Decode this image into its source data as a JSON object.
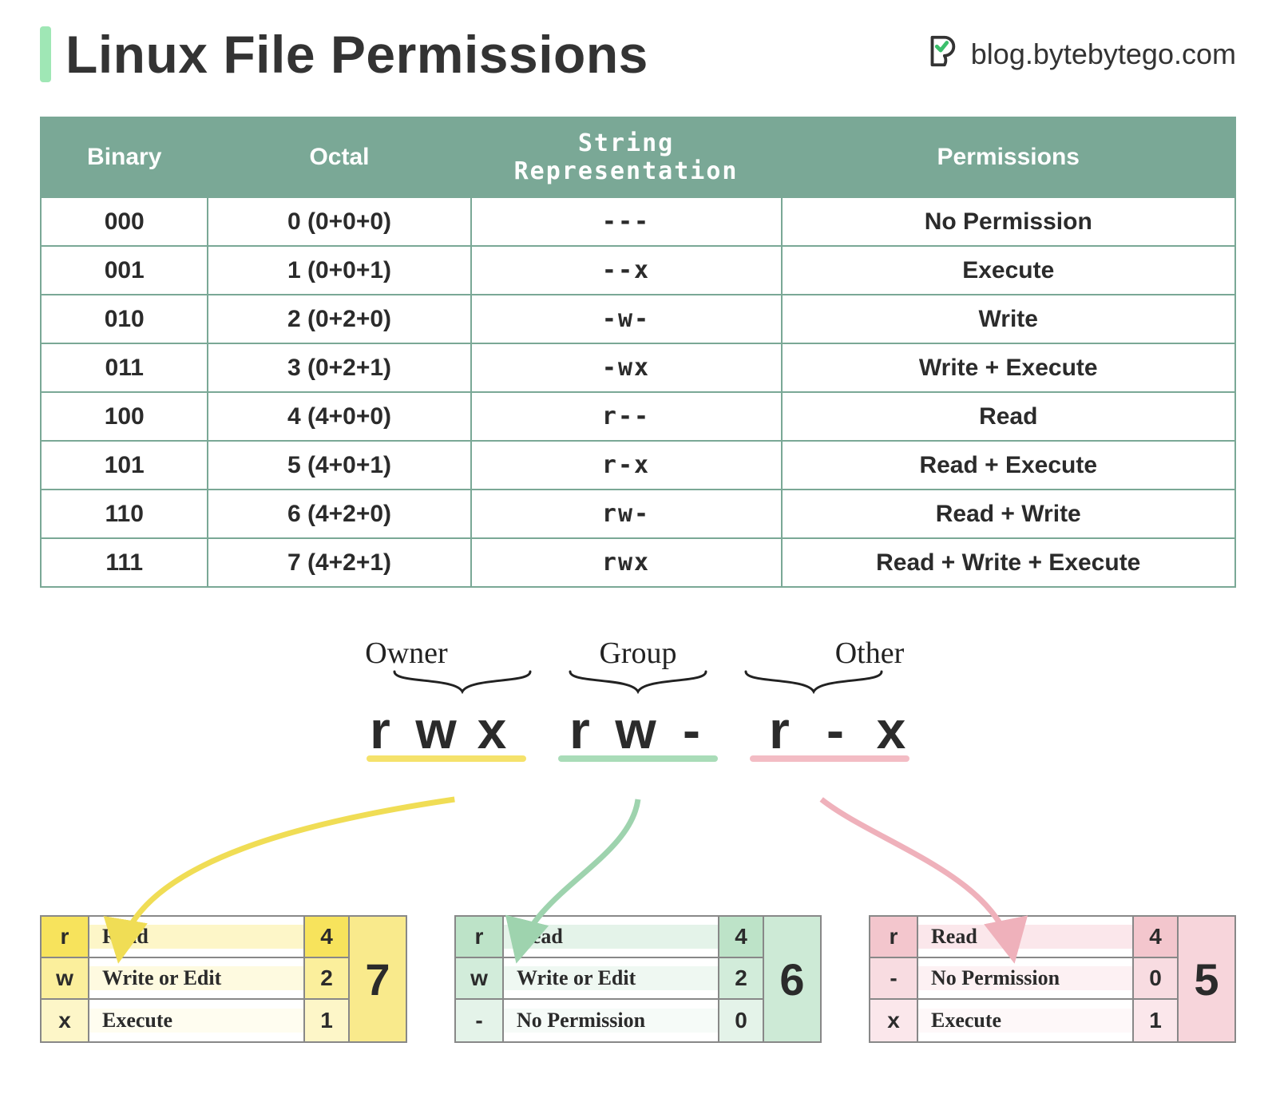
{
  "header": {
    "title": "Linux File Permissions",
    "brand_text": "blog.bytebytego.com",
    "logo_name": "bytebytego-logo"
  },
  "table": {
    "headers": [
      "Binary",
      "Octal",
      "String Representation",
      "Permissions"
    ],
    "rows": [
      {
        "binary": "000",
        "octal": "0 (0+0+0)",
        "string": "---",
        "perm": "No Permission"
      },
      {
        "binary": "001",
        "octal": "1 (0+0+1)",
        "string": "--x",
        "perm": "Execute"
      },
      {
        "binary": "010",
        "octal": "2 (0+2+0)",
        "string": "-w-",
        "perm": "Write"
      },
      {
        "binary": "011",
        "octal": "3 (0+2+1)",
        "string": "-wx",
        "perm": "Write + Execute"
      },
      {
        "binary": "100",
        "octal": "4 (4+0+0)",
        "string": "r--",
        "perm": "Read"
      },
      {
        "binary": "101",
        "octal": "5 (4+0+1)",
        "string": "r-x",
        "perm": "Read + Execute"
      },
      {
        "binary": "110",
        "octal": "6 (4+2+0)",
        "string": "rw-",
        "perm": "Read + Write"
      },
      {
        "binary": "111",
        "octal": "7 (4+2+1)",
        "string": "rwx",
        "perm": "Read + Write + Execute"
      }
    ]
  },
  "example": {
    "roles": [
      "Owner",
      "Group",
      "Other"
    ],
    "chars": [
      "r",
      "w",
      "x",
      "r",
      "w",
      "-",
      "r",
      "-",
      "x"
    ]
  },
  "breakdowns": [
    {
      "color": "yellow",
      "sum": "7",
      "rows": [
        {
          "sym": "r",
          "desc": "Read",
          "val": "4"
        },
        {
          "sym": "w",
          "desc": "Write or Edit",
          "val": "2"
        },
        {
          "sym": "x",
          "desc": "Execute",
          "val": "1"
        }
      ]
    },
    {
      "color": "green",
      "sum": "6",
      "rows": [
        {
          "sym": "r",
          "desc": "Read",
          "val": "4"
        },
        {
          "sym": "w",
          "desc": "Write or Edit",
          "val": "2"
        },
        {
          "sym": "-",
          "desc": "No Permission",
          "val": "0"
        }
      ]
    },
    {
      "color": "pink",
      "sum": "5",
      "rows": [
        {
          "sym": "r",
          "desc": "Read",
          "val": "4"
        },
        {
          "sym": "-",
          "desc": "No Permission",
          "val": "0"
        },
        {
          "sym": "x",
          "desc": "Execute",
          "val": "1"
        }
      ]
    }
  ],
  "colors": {
    "table_header": "#7aa896",
    "accent": "#9fe7b5",
    "yellow": "#f5e164",
    "green": "#a9dcb8",
    "pink": "#f3bcc4"
  }
}
